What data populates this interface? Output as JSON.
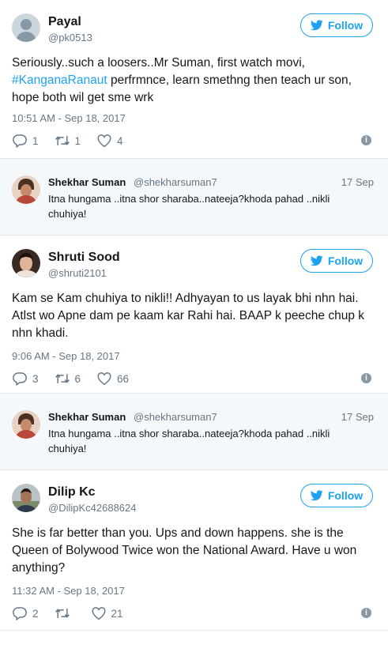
{
  "colors": {
    "accent": "#1da1f2",
    "muted": "#657786",
    "quote_bg": "#f5f8fa"
  },
  "follow_label": "Follow",
  "tweets": [
    {
      "name": "Payal",
      "handle": "@pk0513",
      "text_before": "Seriously..such a loosers..Mr Suman, first watch movi, ",
      "hashtag": "#KanganaRanaut",
      "text_after": " perfrmnce, learn smethng then teach ur son, hope both wil get sme wrk",
      "time": "10:51 AM - Sep 18, 2017",
      "replies": "1",
      "retweets": "1",
      "likes": "4"
    },
    {
      "name": "Shruti Sood",
      "handle": "@shruti2101",
      "text": "Kam se Kam chuhiya to nikli!! Adhyayan to us layak bhi nhn hai. Atlst wo Apne dam pe kaam kar Rahi hai. BAAP k peeche chup k nhn khadi.",
      "time": "9:06 AM - Sep 18, 2017",
      "replies": "3",
      "retweets": "6",
      "likes": "66"
    },
    {
      "name": "Dilip Kc",
      "handle": "@DilipKc42688624",
      "text": "She is far better than you. Ups and down happens. she is the Queen of Bolywood Twice won the National Award. Have u won anything?",
      "time": "11:32 AM - Sep 18, 2017",
      "replies": "2",
      "retweets": "",
      "likes": "21"
    }
  ],
  "quoted": {
    "name": "Shekhar Suman",
    "handle": "@shekharsuman7",
    "date": "17 Sep",
    "text": "Itna hungama ..itna shor sharaba..nateeja?khoda pahad ..nikli chuhiya!"
  }
}
